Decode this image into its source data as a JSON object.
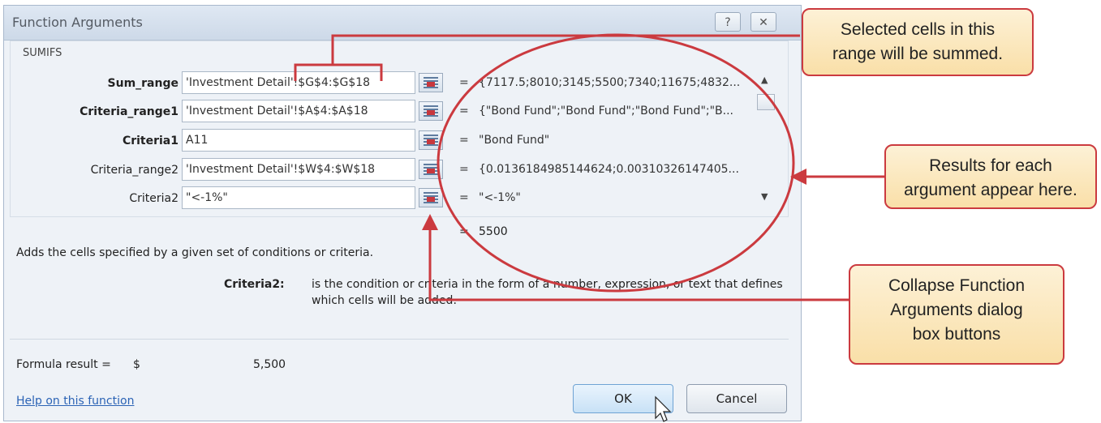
{
  "dialog": {
    "title": "Function Arguments",
    "help_glyph": "?",
    "close_glyph": "✕",
    "function_name": "SUMIFS",
    "args": [
      {
        "label": "Sum_range",
        "value": "'Investment Detail'!$G$4:$G$18",
        "result": "{7117.5;8010;3145;5500;7340;11675;4832..."
      },
      {
        "label": "Criteria_range1",
        "value": "'Investment Detail'!$A$4:$A$18",
        "result": "{\"Bond Fund\";\"Bond Fund\";\"Bond Fund\";\"B..."
      },
      {
        "label": "Criteria1",
        "value": "A11",
        "result": "\"Bond Fund\""
      },
      {
        "label": "Criteria_range2",
        "value": "'Investment Detail'!$W$4:$W$18",
        "result": "{0.0136184985144624;0.00310326147405..."
      },
      {
        "label": "Criteria2",
        "value": "\"<-1%\"",
        "result": "\"<-1%\""
      }
    ],
    "equals": "=",
    "total_result": "5500",
    "description": "Adds the cells specified by a given set of conditions or criteria.",
    "arg_help_name": "Criteria2:",
    "arg_help_line1": "is the condition or criteria in the form of a number, expression, or text that defines",
    "arg_help_line2": "which cells will be added.",
    "formula_result_label": "Formula result =",
    "formula_currency": "$",
    "formula_result_value": "5,500",
    "help_link": "Help on this function",
    "ok_label": "OK",
    "cancel_label": "Cancel"
  },
  "callouts": {
    "selected": [
      "Selected cells in this",
      "range will be summed."
    ],
    "results": [
      "Results for each",
      "argument appear here."
    ],
    "collapse": [
      "Collapse Function",
      "Arguments dialog",
      "box buttons"
    ]
  },
  "colors": {
    "annotation_red": "#cb3a3f",
    "callout_fill": "#f9dfa8"
  }
}
